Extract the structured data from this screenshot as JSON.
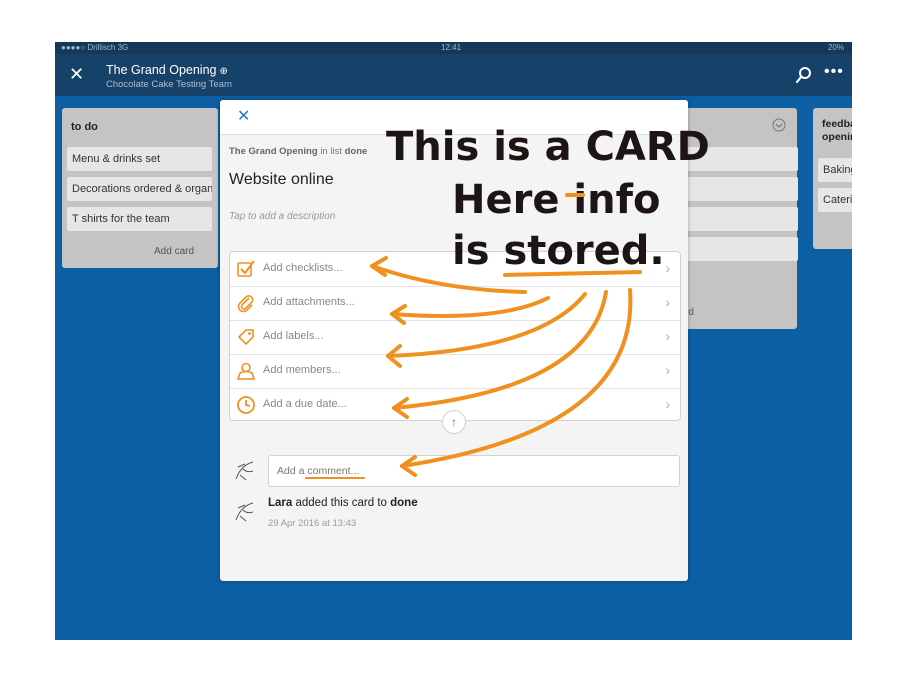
{
  "status": {
    "carrier": "●●●●○ Drillisch 3G",
    "time": "12:41",
    "battery": "20%"
  },
  "nav": {
    "board_title": "The Grand Opening",
    "team": "Chocolate Cake Testing Team"
  },
  "lists": [
    {
      "title": "to do",
      "cards": [
        "Menu & drinks set",
        "Decorations ordered & organised",
        "T shirts for the team"
      ],
      "add": "Add card"
    },
    {
      "title": "",
      "cards": [],
      "add": "rd"
    },
    {
      "title": "feedback opening",
      "cards": [
        "Baking",
        "Catering"
      ]
    }
  ],
  "card": {
    "board": "The Grand Opening",
    "in_list": "in list",
    "list": "done",
    "title": "Website online",
    "description_placeholder": "Tap to add a description",
    "options": [
      {
        "label": "Add checklists...",
        "icon": "checklist-icon"
      },
      {
        "label": "Add attachments...",
        "icon": "paperclip-icon"
      },
      {
        "label": "Add labels...",
        "icon": "tag-icon"
      },
      {
        "label": "Add members...",
        "icon": "person-icon"
      },
      {
        "label": "Add a due date...",
        "icon": "clock-icon"
      }
    ],
    "comment_placeholder": "Add a comment...",
    "activity": {
      "user": "Lara",
      "action": "added this card to",
      "target": "done",
      "time": "29 Apr 2016 at 13:43"
    }
  },
  "annotation": {
    "line1": "This is a CARD",
    "line2": "Here info",
    "line3": "is stored."
  },
  "colors": {
    "board_bg": "#0c5fa3",
    "navbar": "#164168",
    "accent": "#2a7abf",
    "annotation": "#f0911f"
  }
}
